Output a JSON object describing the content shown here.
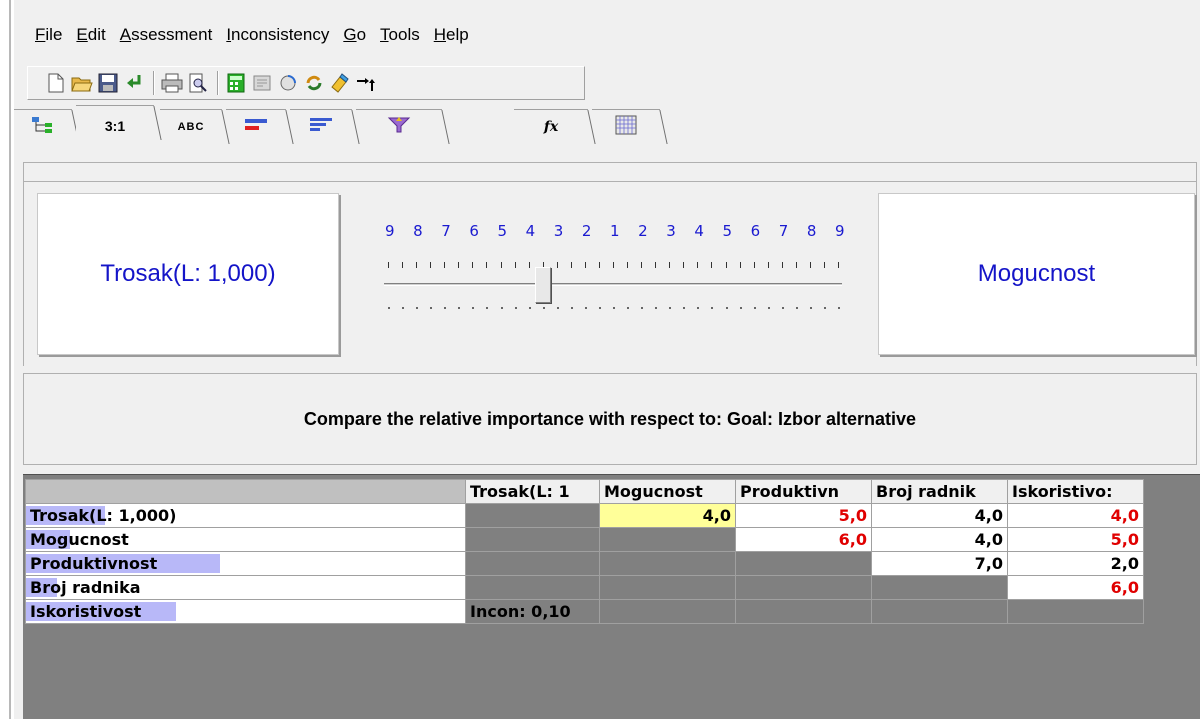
{
  "menu": [
    {
      "label": "File",
      "u": "F",
      "rest": "ile"
    },
    {
      "label": "Edit",
      "u": "E",
      "rest": "dit"
    },
    {
      "label": "Assessment",
      "u": "A",
      "rest": "ssessment"
    },
    {
      "label": "Inconsistency",
      "u": "I",
      "rest": "nconsistency"
    },
    {
      "label": "Go",
      "u": "G",
      "rest": "o"
    },
    {
      "label": "Tools",
      "u": "T",
      "rest": "ools"
    },
    {
      "label": "Help",
      "u": "H",
      "rest": "elp"
    }
  ],
  "toolbar": {
    "icons": [
      "new-file-icon",
      "open-folder-icon",
      "save-icon",
      "import-icon",
      "print-icon",
      "print-preview-icon",
      "calculator-icon",
      "document-icon",
      "refresh-icon",
      "sync-icon",
      "eraser-icon",
      "arrows-icon"
    ]
  },
  "tabs": {
    "tree_label": "",
    "verbal_label": "3:1",
    "abc_label": "ABC",
    "fx_label": "fx"
  },
  "comparison": {
    "left_label": "Trosak(L: 1,000)",
    "right_label": "Mogucnost",
    "scale": [
      "9",
      "8",
      "7",
      "6",
      "5",
      "4",
      "3",
      "2",
      "1",
      "2",
      "3",
      "4",
      "5",
      "6",
      "7",
      "8",
      "9"
    ],
    "slider_value": 4,
    "slider_side": "left"
  },
  "instruction": "Compare the relative importance with respect to: Goal: Izbor alternative",
  "matrix": {
    "columns": [
      "Trosak(L: 1",
      "Mogucnost",
      "Produktivn",
      "Broj radnik",
      "Iskoristivo:"
    ],
    "rows": [
      {
        "label": "Trosak(L: 1,000)",
        "bar_fraction": 0.18,
        "cells": [
          "",
          "4,0",
          "5,0",
          "4,0",
          "4,0"
        ],
        "colors": [
          "gray",
          "black",
          "red",
          "black",
          "red"
        ]
      },
      {
        "label": "Mogucnost",
        "bar_fraction": 0.1,
        "cells": [
          "",
          "",
          "6,0",
          "4,0",
          "5,0"
        ],
        "colors": [
          "gray",
          "gray",
          "red",
          "black",
          "red"
        ]
      },
      {
        "label": "Produktivnost",
        "bar_fraction": 0.44,
        "cells": [
          "",
          "",
          "",
          "7,0",
          "2,0"
        ],
        "colors": [
          "gray",
          "gray",
          "gray",
          "black",
          "black"
        ]
      },
      {
        "label": "Broj radnika",
        "bar_fraction": 0.07,
        "cells": [
          "",
          "",
          "",
          "",
          "6,0"
        ],
        "colors": [
          "gray",
          "gray",
          "gray",
          "gray",
          "red"
        ]
      },
      {
        "label": "Iskoristivost",
        "bar_fraction": 0.34,
        "cells": [
          "Incon: 0,10",
          "",
          "",
          "",
          ""
        ],
        "colors": [
          "incon",
          "gray",
          "gray",
          "gray",
          "gray"
        ]
      }
    ]
  },
  "colors": {
    "accent_text": "#1414c8",
    "red_value": "#e00000",
    "highlight": "#ffff99",
    "priority_bar": "#b8b8f8"
  }
}
